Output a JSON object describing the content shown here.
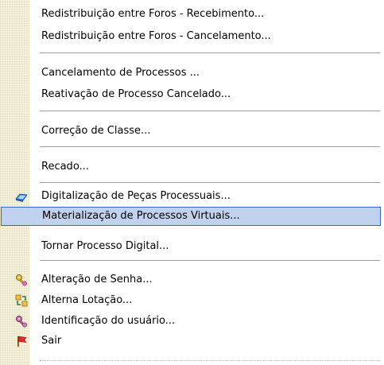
{
  "menu": {
    "items": [
      {
        "label": "Redistribuição entre Foros - Recebimento..."
      },
      {
        "label": "Redistribuição entre Foros - Cancelamento..."
      },
      {
        "label": "Cancelamento de Processos ..."
      },
      {
        "label": "Reativação de Processo Cancelado..."
      },
      {
        "label": "Correção de Classe..."
      },
      {
        "label": "Recado..."
      },
      {
        "label": "Digitalização de Peças Processuais...",
        "icon": "scanner-icon"
      },
      {
        "label": "Materialização de Processos Virtuais...",
        "highlighted": true
      },
      {
        "label": "Tornar Processo Digital..."
      },
      {
        "label": "Alteração de Senha...",
        "icon": "key-icon"
      },
      {
        "label": "Alterna Lotação...",
        "icon": "switch-lotacao-icon"
      },
      {
        "label": "Identificação do usuário...",
        "icon": "user-id-key-icon"
      },
      {
        "label": "Sair",
        "icon": "exit-flag-icon"
      }
    ],
    "colors": {
      "highlight_background": "#c1d2ee",
      "highlight_border": "#316ac5",
      "gutter": "#f6f3df",
      "separator": "#9d9d9d"
    }
  }
}
